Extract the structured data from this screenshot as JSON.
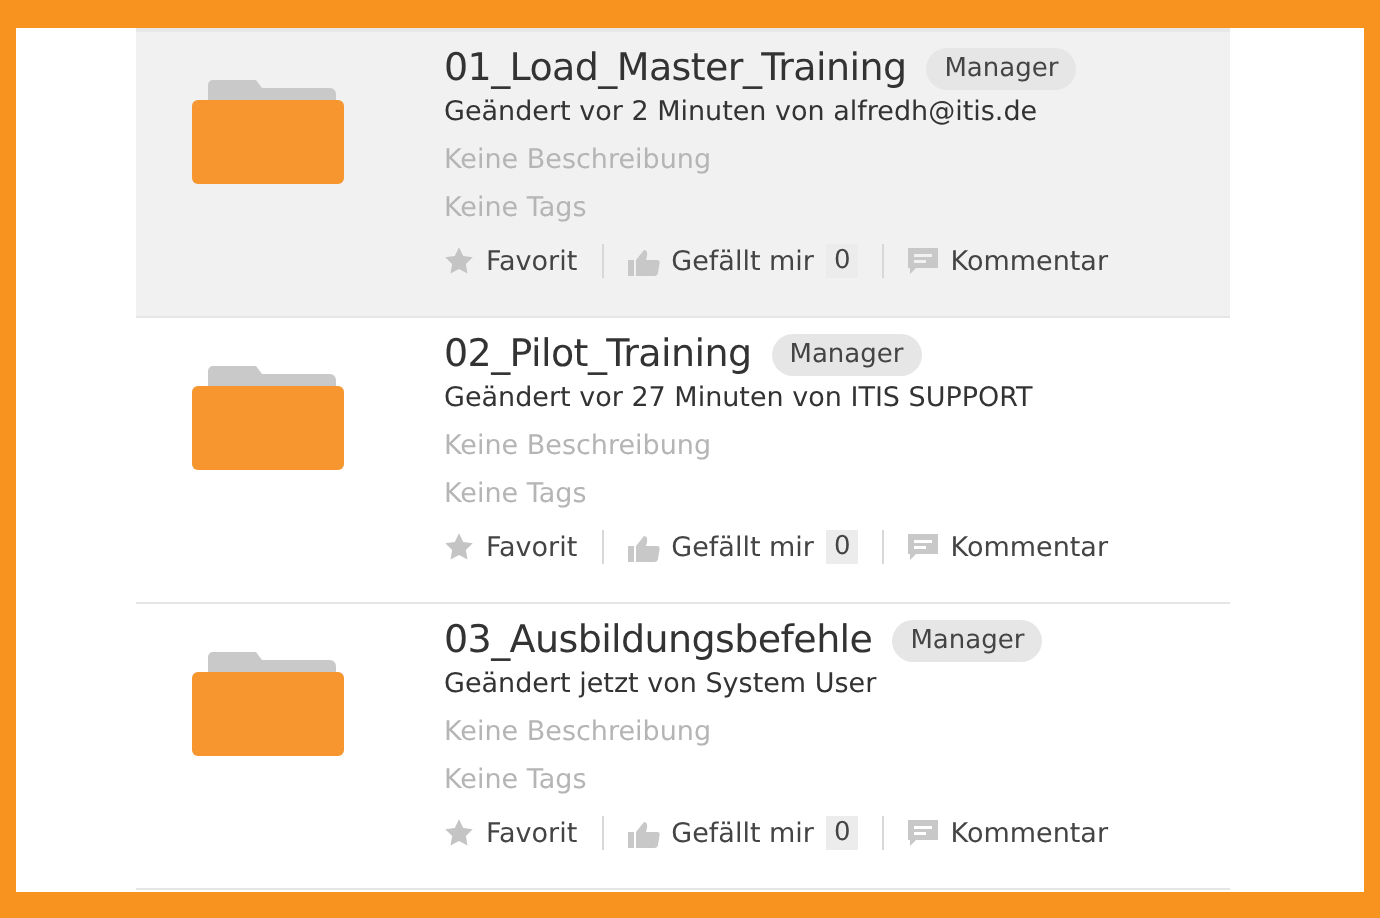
{
  "folders": [
    {
      "name": "01_Load_Master_Training",
      "role": "Manager",
      "modified": "Geändert vor 2 Minuten von alfredh@itis.de",
      "description": "Keine Beschreibung",
      "tags": "Keine Tags",
      "favorite": "Favorit",
      "like": "Gefällt mir",
      "like_count": "0",
      "comment": "Kommentar",
      "selected": true
    },
    {
      "name": "02_Pilot_Training",
      "role": "Manager",
      "modified": "Geändert vor 27 Minuten von ITIS SUPPORT",
      "description": "Keine Beschreibung",
      "tags": "Keine Tags",
      "favorite": "Favorit",
      "like": "Gefällt mir",
      "like_count": "0",
      "comment": "Kommentar",
      "selected": false
    },
    {
      "name": "03_Ausbildungsbefehle",
      "role": "Manager",
      "modified": "Geändert jetzt von System User",
      "description": "Keine Beschreibung",
      "tags": "Keine Tags",
      "favorite": "Favorit",
      "like": "Gefällt mir",
      "like_count": "0",
      "comment": "Kommentar",
      "selected": false
    }
  ]
}
